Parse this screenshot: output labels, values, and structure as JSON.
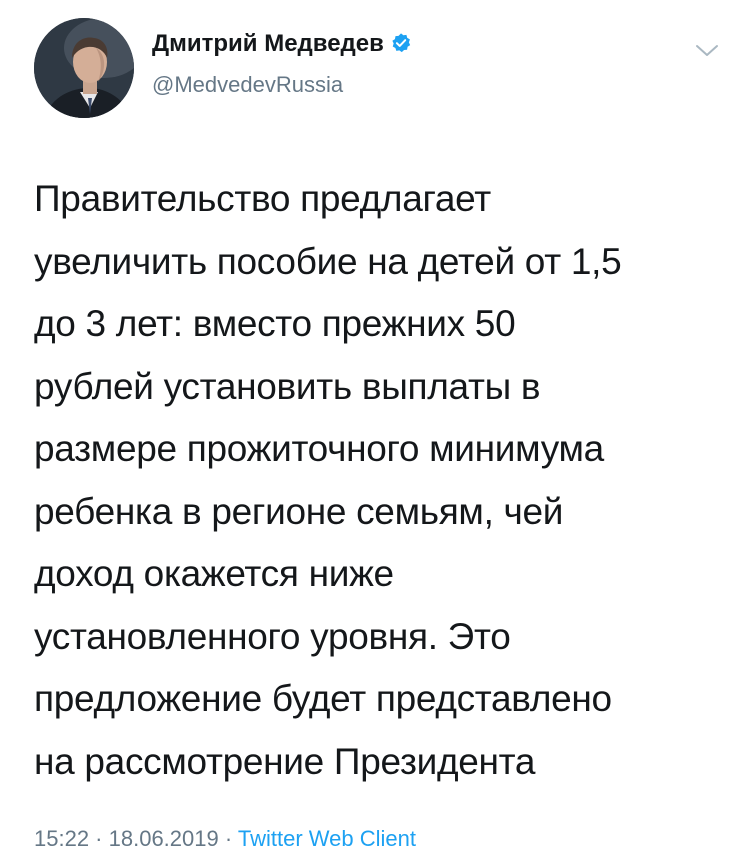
{
  "author": {
    "name": "Дмитрий Медведев",
    "handle": "@MedvedevRussia",
    "verified": true,
    "avatar_icon": "user-photo"
  },
  "tweet": {
    "lines": [
      "Правительство предлагает",
      "увеличить пособие на детей от 1,5",
      "до 3 лет: вместо прежних 50",
      "рублей установить выплаты в",
      "размере прожиточного минимума",
      "ребенка в регионе семьям, чей",
      "доход окажется ниже",
      "установленного уровня. Это",
      "предложение будет представлено",
      "на рассмотрение Президента"
    ]
  },
  "meta": {
    "time": "15:22",
    "separator": " · ",
    "date": "18.06.2019",
    "source": "Twitter Web Client"
  },
  "colors": {
    "text": "#14171a",
    "muted": "#657786",
    "accent": "#1da1f2"
  }
}
